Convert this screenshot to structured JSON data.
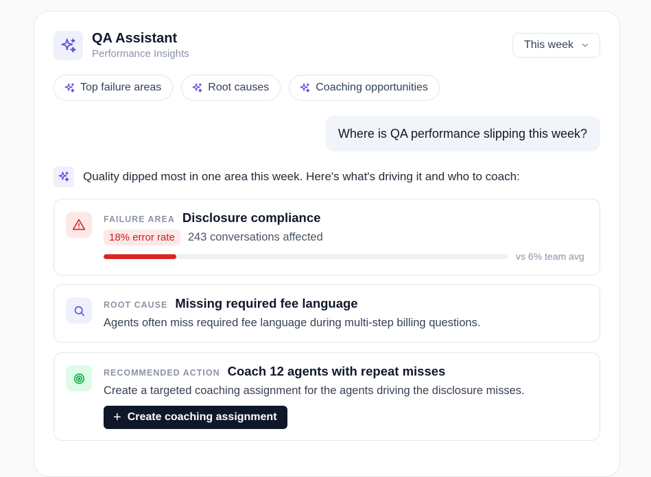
{
  "header": {
    "title": "QA Assistant",
    "subtitle": "Performance Insights",
    "range": "This week"
  },
  "chips": [
    {
      "label": "Top failure areas"
    },
    {
      "label": "Root causes"
    },
    {
      "label": "Coaching opportunities"
    }
  ],
  "conversation": {
    "user_message": "Where is QA performance slipping this week?",
    "assistant_message": "Quality dipped most in one area this week. Here's what's driving it and who to coach:"
  },
  "failure_card": {
    "eyebrow": "FAILURE AREA",
    "title": "Disclosure compliance",
    "error_rate": "18% error rate",
    "affected": "243 conversations affected",
    "error_rate_value": 18,
    "comparison": "vs 6% team avg"
  },
  "root_card": {
    "eyebrow": "ROOT CAUSE",
    "title": "Missing required fee language",
    "description": "Agents often miss required fee language during multi-step billing questions."
  },
  "action_card": {
    "eyebrow": "RECOMMENDED ACTION",
    "title": "Coach 12 agents with repeat misses",
    "description": "Create a targeted coaching assignment for the agents driving the disclosure misses.",
    "button_label": "Create coaching assignment"
  },
  "colors": {
    "accent": "#5b4bdb",
    "danger": "#dc2626",
    "success": "#16a34a",
    "dark": "#0f172a"
  }
}
